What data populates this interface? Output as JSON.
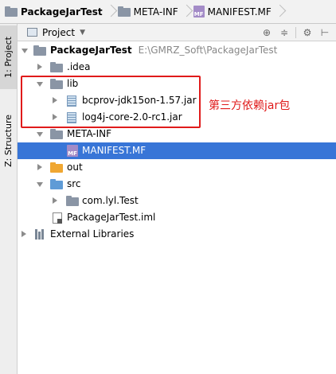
{
  "breadcrumb": {
    "items": [
      "PackageJarTest",
      "META-INF",
      "MANIFEST.MF"
    ]
  },
  "left_strip": {
    "project_tab": "1: Project",
    "structure_tab": "Z: Structure"
  },
  "panel": {
    "title": "Project"
  },
  "tree": {
    "root_label": "PackageJarTest",
    "root_path": "E:\\GMRZ_Soft\\PackageJarTest",
    "idea": ".idea",
    "lib": "lib",
    "jar1": "bcprov-jdk15on-1.57.jar",
    "jar2": "log4j-core-2.0-rc1.jar",
    "metainf": "META-INF",
    "manifest": "MANIFEST.MF",
    "out": "out",
    "src": "src",
    "pkg": "com.lyl.Test",
    "iml": "PackageJarTest.iml",
    "ext": "External Libraries"
  },
  "icons": {
    "mf_badge": "MF"
  },
  "annotation": {
    "text": "第三方依赖jar包"
  },
  "colors": {
    "selection": "#3875d7",
    "annotation_red": "#e01b1b",
    "folder_gray": "#8a95a5",
    "folder_orange": "#f0a732",
    "folder_blue": "#5f9bd6"
  }
}
